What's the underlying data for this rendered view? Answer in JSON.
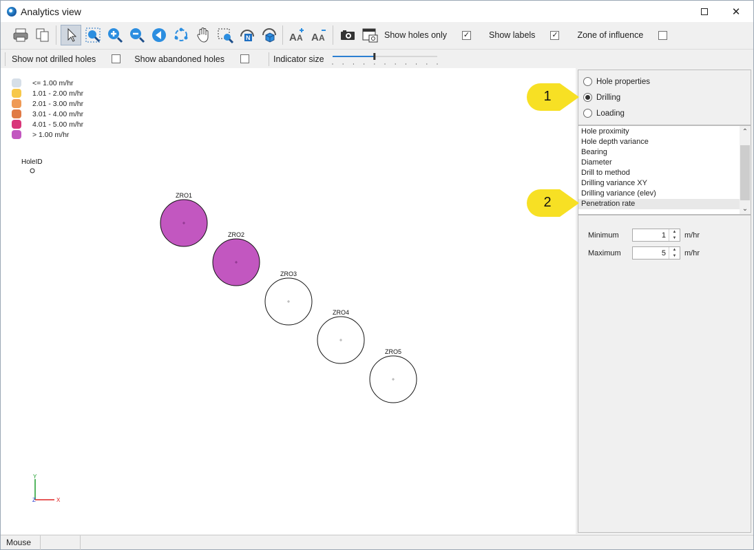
{
  "window": {
    "title": "Analytics view",
    "close_glyph": "✕"
  },
  "toolbar": {
    "icons": [
      "print-icon",
      "copy-icon",
      "select-pointer-icon",
      "zoom-extents-icon",
      "zoom-in-icon",
      "zoom-out-icon",
      "zoom-previous-icon",
      "rotate-icon",
      "pan-hand-icon",
      "zoom-window-icon",
      "north-arrow-icon",
      "3d-view-icon",
      "text-larger-icon",
      "text-smaller-icon",
      "camera-icon",
      "screenshot-window-icon"
    ],
    "show_holes_only": {
      "label": "Show holes only",
      "checked": true
    },
    "show_labels": {
      "label": "Show labels",
      "checked": true
    },
    "zone_of_influence": {
      "label": "Zone of influence",
      "checked": false
    },
    "show_not_drilled": {
      "label": "Show not drilled holes",
      "checked": false
    },
    "show_abandoned": {
      "label": "Show abandoned holes",
      "checked": false
    },
    "indicator_size": {
      "label": "Indicator size",
      "value": 0.4
    }
  },
  "legend": [
    {
      "label": "<= 1.00 m/hr",
      "color": "#d6dfe8"
    },
    {
      "label": "1.01 - 2.00 m/hr",
      "color": "#f7c84a"
    },
    {
      "label": "2.01 - 3.00 m/hr",
      "color": "#ef9a55"
    },
    {
      "label": "3.01 - 4.00 m/hr",
      "color": "#e07a45"
    },
    {
      "label": "4.01 - 5.00 m/hr",
      "color": "#d9367a"
    },
    {
      "label": "> 1.00 m/hr",
      "color": "#c257c0"
    }
  ],
  "holeid_label": "HoleID",
  "holes": [
    {
      "id": "ZRO1",
      "color": "#c257c0"
    },
    {
      "id": "ZRO2",
      "color": "#c257c0"
    },
    {
      "id": "ZRO3",
      "color": "#ffffff"
    },
    {
      "id": "ZRO4",
      "color": "#ffffff"
    },
    {
      "id": "ZRO5",
      "color": "#ffffff"
    }
  ],
  "axes": {
    "y": "Y",
    "z": "Z",
    "x": "X"
  },
  "panel": {
    "radios": [
      {
        "label": "Hole properties",
        "checked": false
      },
      {
        "label": "Drilling",
        "checked": true
      },
      {
        "label": "Loading",
        "checked": false
      }
    ],
    "list_items": [
      "Hole proximity",
      "Hole depth variance",
      "Bearing",
      "Diameter",
      "Drill to method",
      "Drilling variance XY",
      "Drilling variance (elev)",
      "Penetration rate"
    ],
    "selected_item": "Penetration rate",
    "minimum": {
      "label": "Minimum",
      "value": "1",
      "unit": "m/hr"
    },
    "maximum": {
      "label": "Maximum",
      "value": "5",
      "unit": "m/hr"
    }
  },
  "callouts": [
    "1",
    "2"
  ],
  "callout_color": "#f7e024",
  "status": {
    "mouse": "Mouse"
  }
}
